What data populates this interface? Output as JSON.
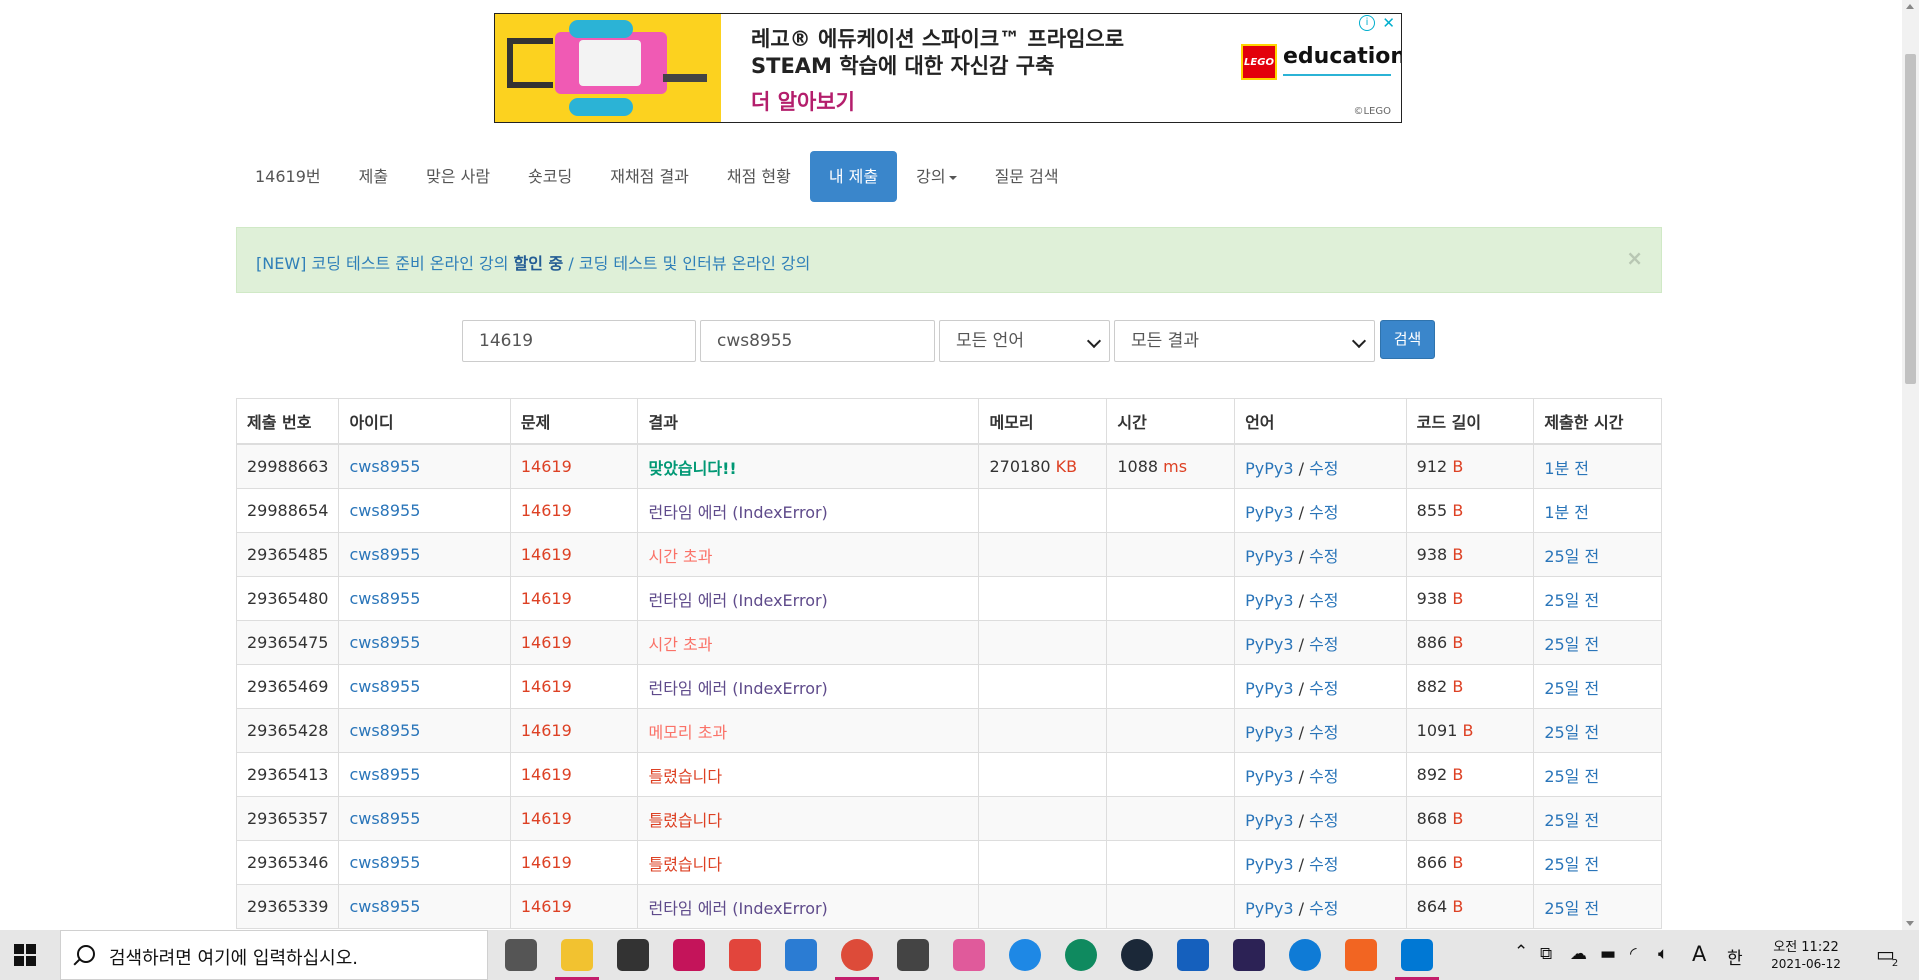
{
  "ad": {
    "line1": "레고® 에듀케이션 스파이크™ 프라임으로",
    "line2": "STEAM 학습에 대한 자신감 구축",
    "cta": "더 알아보기",
    "logo": "LEGO",
    "brand": "education",
    "copyright": "©LEGO",
    "info": "ⓘ",
    "close": "✕"
  },
  "nav": {
    "items": [
      {
        "label": "14619번",
        "active": false
      },
      {
        "label": "제출",
        "active": false
      },
      {
        "label": "맞은 사람",
        "active": false
      },
      {
        "label": "숏코딩",
        "active": false
      },
      {
        "label": "재채점 결과",
        "active": false
      },
      {
        "label": "채점 현황",
        "active": false
      },
      {
        "label": "내 제출",
        "active": true
      },
      {
        "label": "강의",
        "active": false,
        "dropdown": true
      },
      {
        "label": "질문 검색",
        "active": false
      }
    ]
  },
  "alert": {
    "prefix": "[NEW] 코딩 테스트 준비 온라인 강의 ",
    "highlight": "할인 중",
    "suffix": " / 코딩 테스트 및 인터뷰 온라인 강의",
    "close": "×"
  },
  "search": {
    "problem_value": "14619",
    "user_value": "cws8955",
    "language_selected": "모든 언어",
    "result_selected": "모든 결과",
    "button": "검색"
  },
  "table": {
    "headers": [
      "제출 번호",
      "아이디",
      "문제",
      "결과",
      "메모리",
      "시간",
      "언어",
      "코드 길이",
      "제출한 시간"
    ],
    "lang_sep": " / ",
    "edit_label": "수정",
    "mem_unit": "KB",
    "time_unit": "ms",
    "len_unit": "B",
    "rows": [
      {
        "id": "29988663",
        "user": "cws8955",
        "problem": "14619",
        "result": "맞았습니다!!",
        "result_type": "ac",
        "result_detail": "",
        "memory": "270180",
        "time": "1088",
        "lang": "PyPy3",
        "length": "912",
        "submitted": "1분 전"
      },
      {
        "id": "29988654",
        "user": "cws8955",
        "problem": "14619",
        "result": "런타임 에러 ",
        "result_type": "rte",
        "result_detail": "(IndexError)",
        "memory": "",
        "time": "",
        "lang": "PyPy3",
        "length": "855",
        "submitted": "1분 전"
      },
      {
        "id": "29365485",
        "user": "cws8955",
        "problem": "14619",
        "result": "시간 초과",
        "result_type": "tle",
        "result_detail": "",
        "memory": "",
        "time": "",
        "lang": "PyPy3",
        "length": "938",
        "submitted": "25일 전"
      },
      {
        "id": "29365480",
        "user": "cws8955",
        "problem": "14619",
        "result": "런타임 에러 ",
        "result_type": "rte",
        "result_detail": "(IndexError)",
        "memory": "",
        "time": "",
        "lang": "PyPy3",
        "length": "938",
        "submitted": "25일 전"
      },
      {
        "id": "29365475",
        "user": "cws8955",
        "problem": "14619",
        "result": "시간 초과",
        "result_type": "tle",
        "result_detail": "",
        "memory": "",
        "time": "",
        "lang": "PyPy3",
        "length": "886",
        "submitted": "25일 전"
      },
      {
        "id": "29365469",
        "user": "cws8955",
        "problem": "14619",
        "result": "런타임 에러 ",
        "result_type": "rte",
        "result_detail": "(IndexError)",
        "memory": "",
        "time": "",
        "lang": "PyPy3",
        "length": "882",
        "submitted": "25일 전"
      },
      {
        "id": "29365428",
        "user": "cws8955",
        "problem": "14619",
        "result": "메모리 초과",
        "result_type": "mle",
        "result_detail": "",
        "memory": "",
        "time": "",
        "lang": "PyPy3",
        "length": "1091",
        "submitted": "25일 전"
      },
      {
        "id": "29365413",
        "user": "cws8955",
        "problem": "14619",
        "result": "틀렸습니다",
        "result_type": "wa",
        "result_detail": "",
        "memory": "",
        "time": "",
        "lang": "PyPy3",
        "length": "892",
        "submitted": "25일 전"
      },
      {
        "id": "29365357",
        "user": "cws8955",
        "problem": "14619",
        "result": "틀렸습니다",
        "result_type": "wa",
        "result_detail": "",
        "memory": "",
        "time": "",
        "lang": "PyPy3",
        "length": "868",
        "submitted": "25일 전"
      },
      {
        "id": "29365346",
        "user": "cws8955",
        "problem": "14619",
        "result": "틀렸습니다",
        "result_type": "wa",
        "result_detail": "",
        "memory": "",
        "time": "",
        "lang": "PyPy3",
        "length": "866",
        "submitted": "25일 전"
      },
      {
        "id": "29365339",
        "user": "cws8955",
        "problem": "14619",
        "result": "런타임 에러 ",
        "result_type": "rte",
        "result_detail": "(IndexError)",
        "memory": "",
        "time": "",
        "lang": "PyPy3",
        "length": "864",
        "submitted": "25일 전"
      }
    ]
  },
  "taskbar": {
    "search_placeholder": "검색하려면 여기에 입력하십시오.",
    "apps": [
      "task-view",
      "file-explorer",
      "store",
      "app-red",
      "app-sync",
      "mail",
      "chrome",
      "app-gear",
      "app-cards",
      "app-blue-circle",
      "app-green-circle",
      "steam",
      "reader",
      "eclipse",
      "edge",
      "app-orange",
      "vscode"
    ],
    "tray_ime_a": "A",
    "tray_ime_lang": "한",
    "clock_ampm_time": "오전 11:22",
    "clock_date": "2021-06-12",
    "notification_count": "2"
  }
}
